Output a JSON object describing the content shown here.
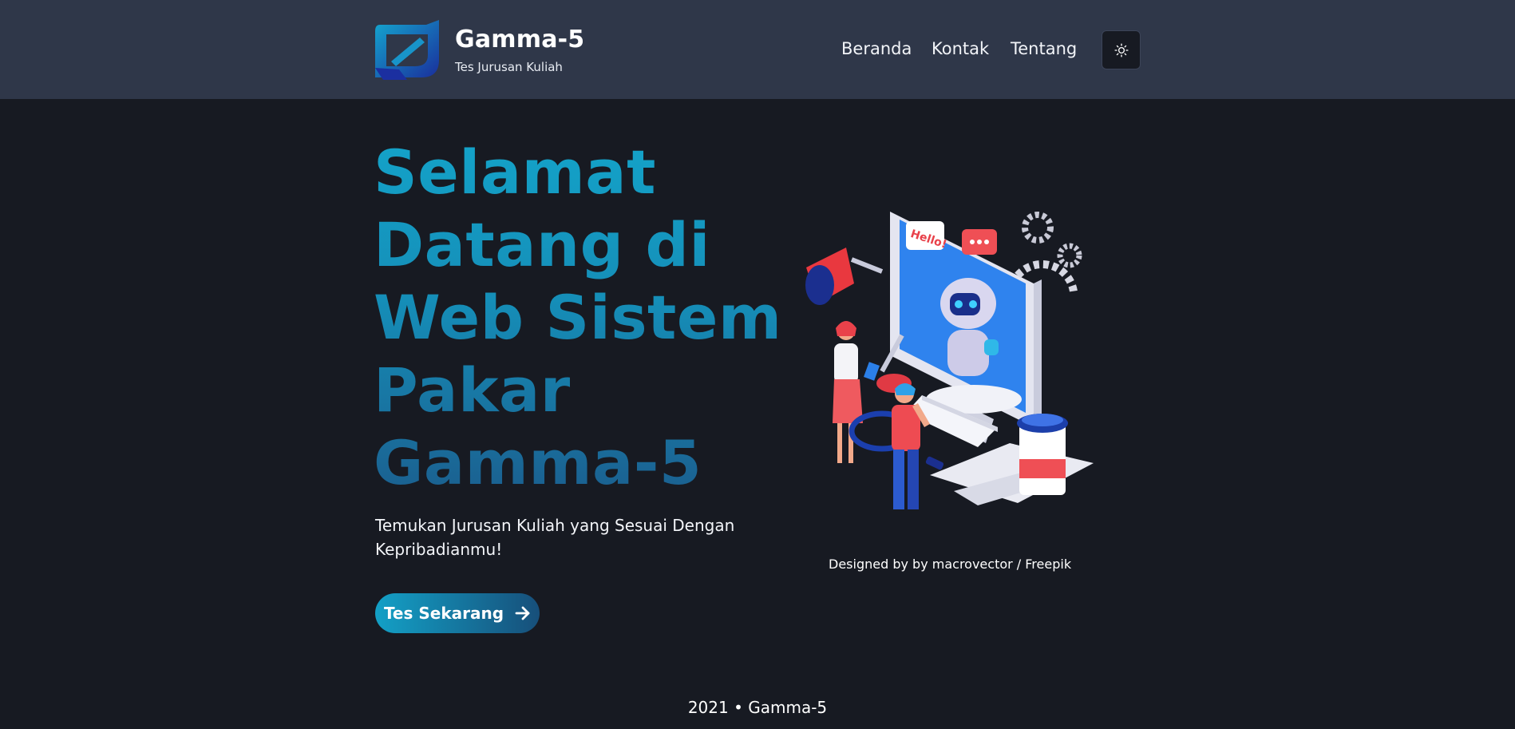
{
  "header": {
    "brand_name": "Gamma-5",
    "brand_tagline": "Tes Jurusan Kuliah",
    "nav": [
      "Beranda",
      "Kontak",
      "Tentang"
    ],
    "theme_icon": "sun-icon"
  },
  "hero": {
    "title_lines": [
      "Selamat",
      "Datang di",
      "Web Sistem",
      "Pakar",
      "Gamma-5"
    ],
    "subtitle": "Temukan Jurusan Kuliah yang Sesuai Dengan Kepribadianmu!",
    "cta_label": "Tes Sekarang",
    "cta_icon": "arrow-right-icon",
    "illustration_credit": "Designed by by macrovector / Freepik"
  },
  "footer": {
    "text": "2021 • Gamma-5"
  },
  "colors": {
    "navbar": "#2f3749",
    "background": "#171a22",
    "accent": "#14a3c9",
    "accent_dark": "#1b5f8f"
  }
}
